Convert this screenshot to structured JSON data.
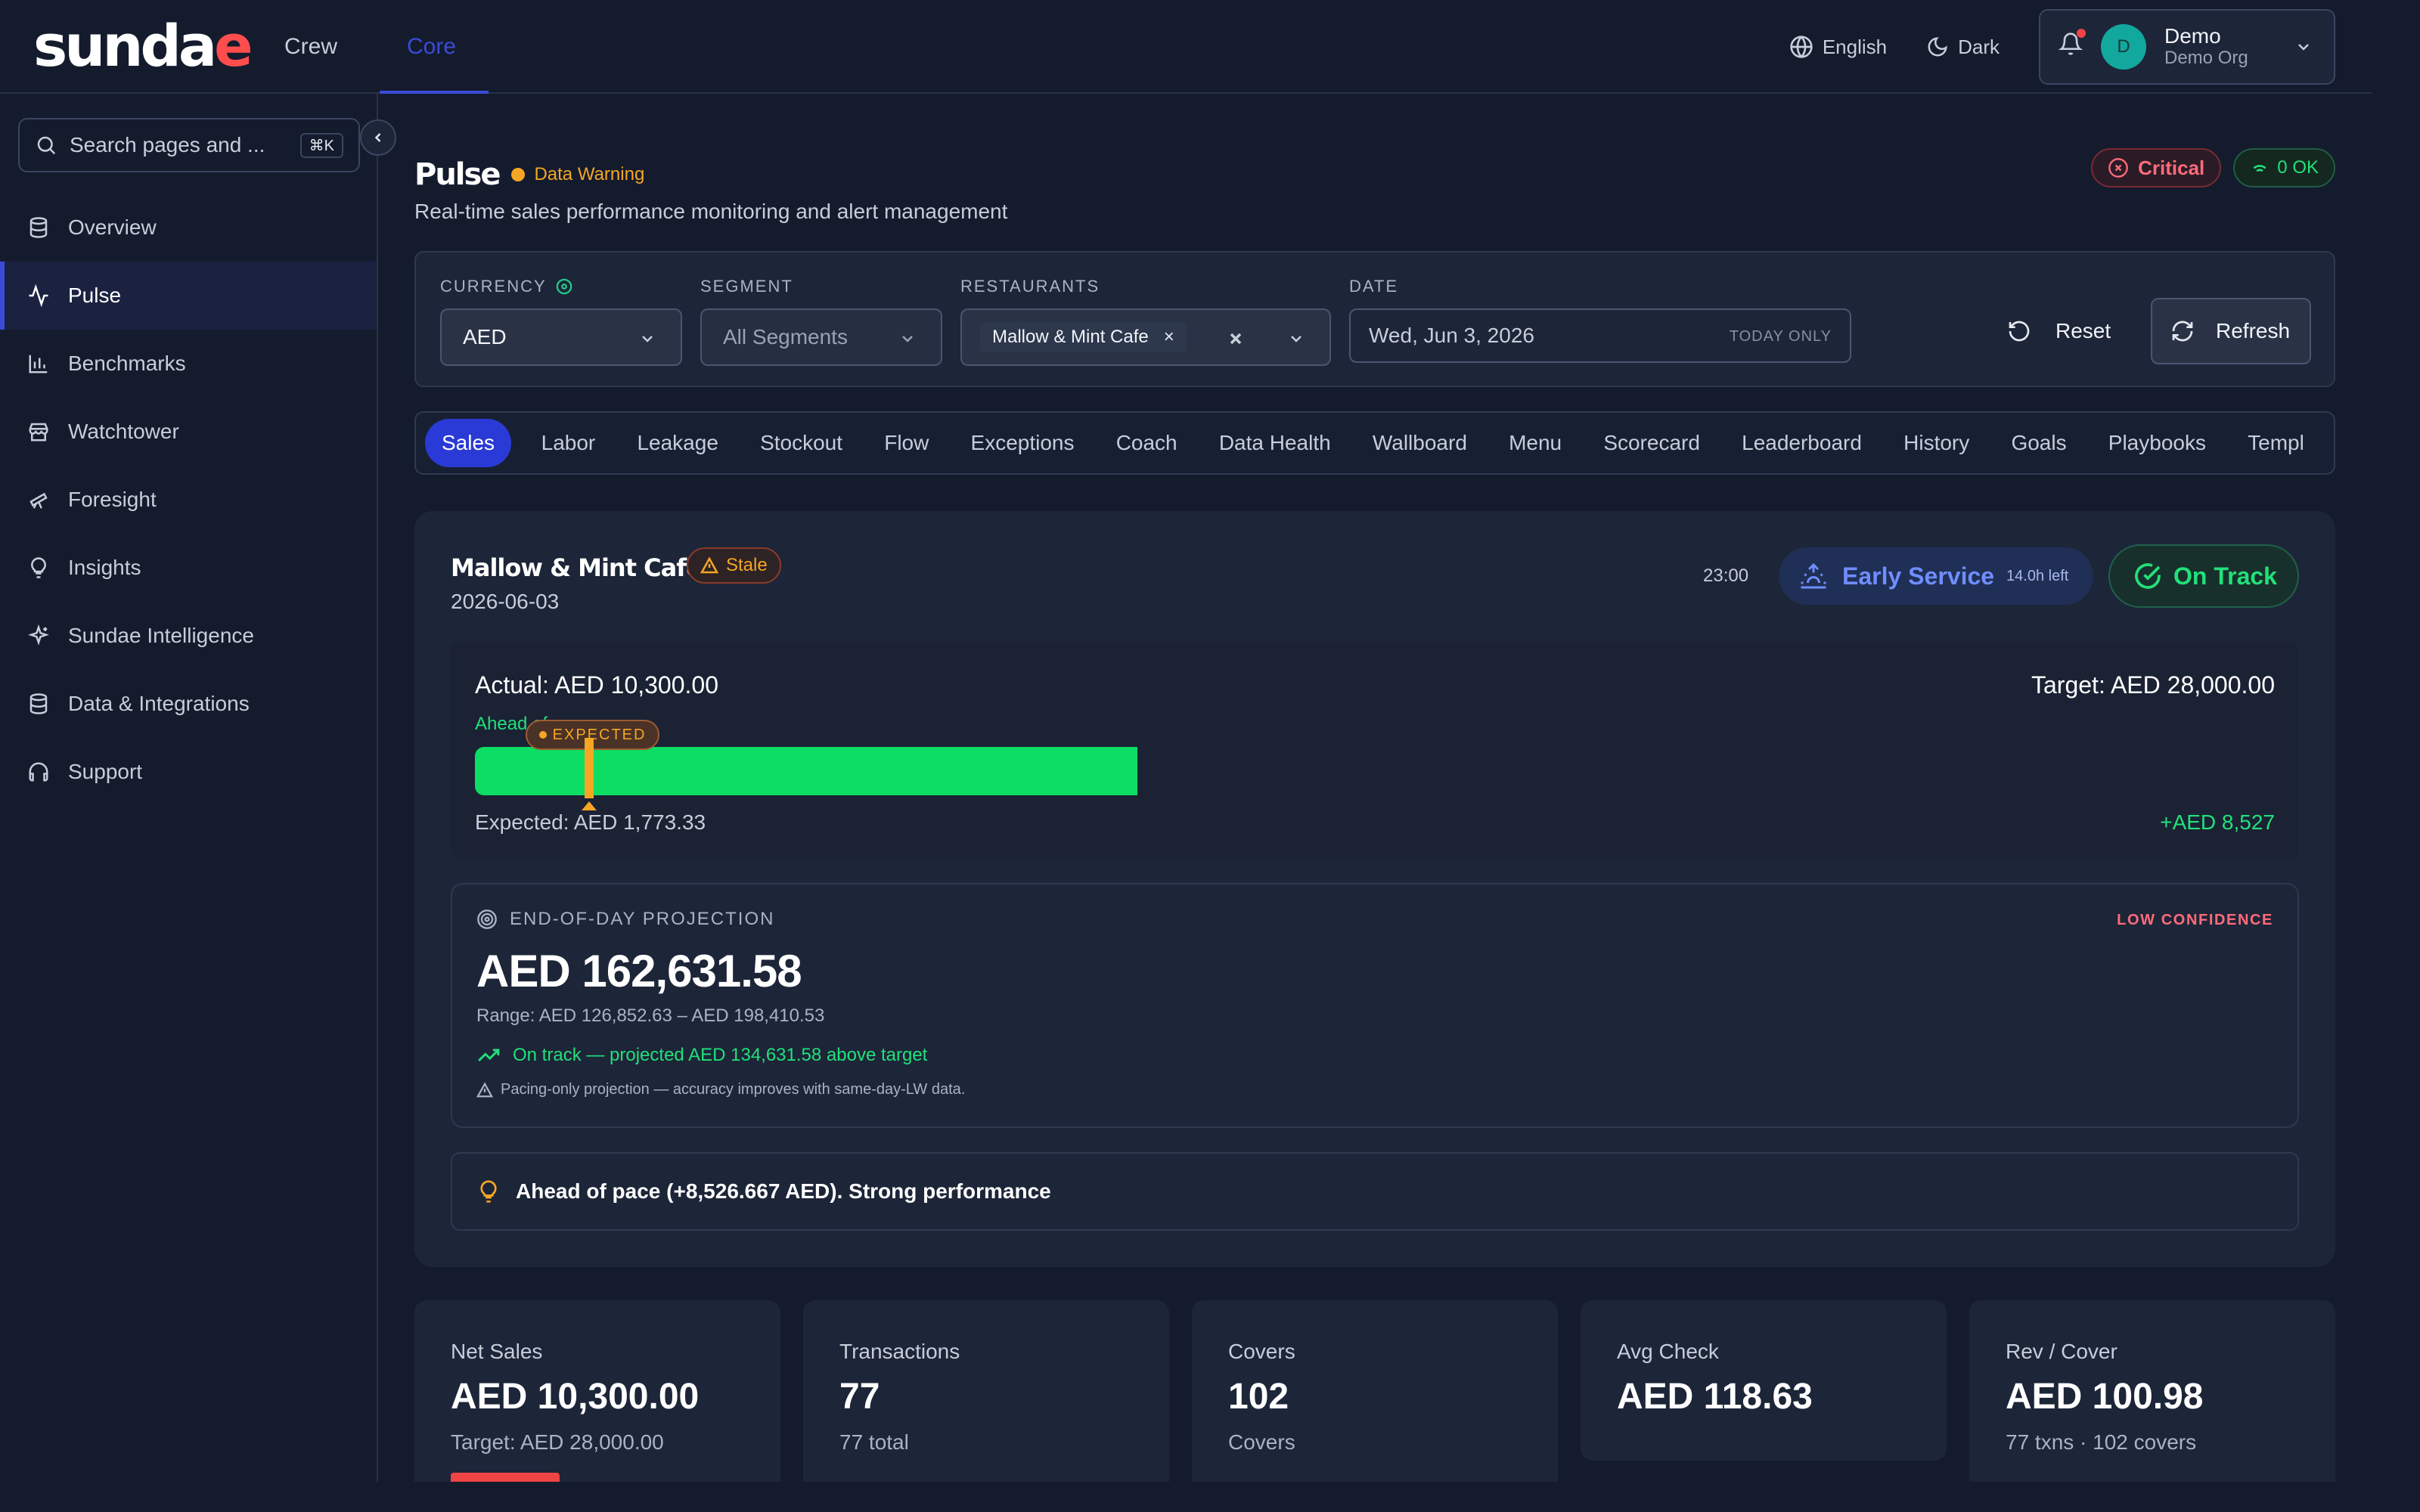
{
  "brand": {
    "logo_main": "sunda",
    "logo_accent": "e"
  },
  "topnav": [
    {
      "label": "Crew"
    },
    {
      "label": "Core"
    }
  ],
  "topbar": {
    "language": "English",
    "theme": "Dark",
    "user_initial": "D",
    "user_name": "Demo",
    "user_org": "Demo Org"
  },
  "sidebar": {
    "search_placeholder": "Search pages and ...",
    "search_shortcut": "⌘K",
    "items": [
      {
        "label": "Overview",
        "icon": "database-icon"
      },
      {
        "label": "Pulse",
        "icon": "activity-icon"
      },
      {
        "label": "Benchmarks",
        "icon": "bar-chart-icon"
      },
      {
        "label": "Watchtower",
        "icon": "store-icon"
      },
      {
        "label": "Foresight",
        "icon": "telescope-icon"
      },
      {
        "label": "Insights",
        "icon": "lightbulb-icon"
      },
      {
        "label": "Sundae Intelligence",
        "icon": "sparkles-icon"
      },
      {
        "label": "Data & Integrations",
        "icon": "database-icon"
      },
      {
        "label": "Support",
        "icon": "headphones-icon"
      }
    ]
  },
  "page": {
    "title": "Pulse",
    "warning": "Data Warning",
    "subtitle": "Real-time sales performance monitoring and alert management",
    "critical": "Critical",
    "ok_count": "0 OK"
  },
  "filters": {
    "currency_label": "CURRENCY",
    "currency_value": "AED",
    "segment_label": "SEGMENT",
    "segment_value": "All Segments",
    "restaurants_label": "RESTAURANTS",
    "restaurant_chip": "Mallow & Mint Cafe",
    "date_label": "DATE",
    "date_value": "Wed, Jun 3, 2026",
    "date_note": "TODAY ONLY",
    "reset": "Reset",
    "refresh": "Refresh"
  },
  "tabs": [
    "Sales",
    "Labor",
    "Leakage",
    "Stockout",
    "Flow",
    "Exceptions",
    "Coach",
    "Data Health",
    "Wallboard",
    "Menu",
    "Scorecard",
    "Leaderboard",
    "History",
    "Goals",
    "Playbooks",
    "Templ"
  ],
  "store": {
    "name": "Mallow & Mint Cafe",
    "stale": "Stale",
    "date": "2026-06-03",
    "time": "23:00",
    "service": "Early Service",
    "time_left": "14.0h left",
    "status": "On Track",
    "actual": "Actual: AED 10,300.00",
    "target": "Target: AED 28,000.00",
    "pace_label": "Ahead of pace",
    "expected_tag": "EXPECTED",
    "expected": "Expected: AED 1,773.33",
    "surplus": "+AED 8,527",
    "progress_fraction": 0.3679,
    "expected_fraction": 0.0633,
    "projection_label": "END-OF-DAY PROJECTION",
    "confidence": "LOW CONFIDENCE",
    "projection_value": "AED 162,631.58",
    "projection_range": "Range: AED 126,852.63 – AED 198,410.53",
    "projection_track": "On track — projected AED 134,631.58 above target",
    "projection_note": "Pacing-only projection — accuracy improves with same-day-LW data.",
    "insight": "Ahead of pace (+8,526.667 AED). Strong performance"
  },
  "kpis": [
    {
      "label": "Net Sales",
      "value": "AED 10,300.00",
      "sub": "Target: AED 28,000.00"
    },
    {
      "label": "Transactions",
      "value": "77",
      "sub": "77 total"
    },
    {
      "label": "Covers",
      "value": "102",
      "sub": "Covers"
    },
    {
      "label": "Avg Check",
      "value": "AED 118.63",
      "sub": ""
    },
    {
      "label": "Rev / Cover",
      "value": "AED 100.98",
      "sub": "77 txns · 102 covers"
    }
  ]
}
